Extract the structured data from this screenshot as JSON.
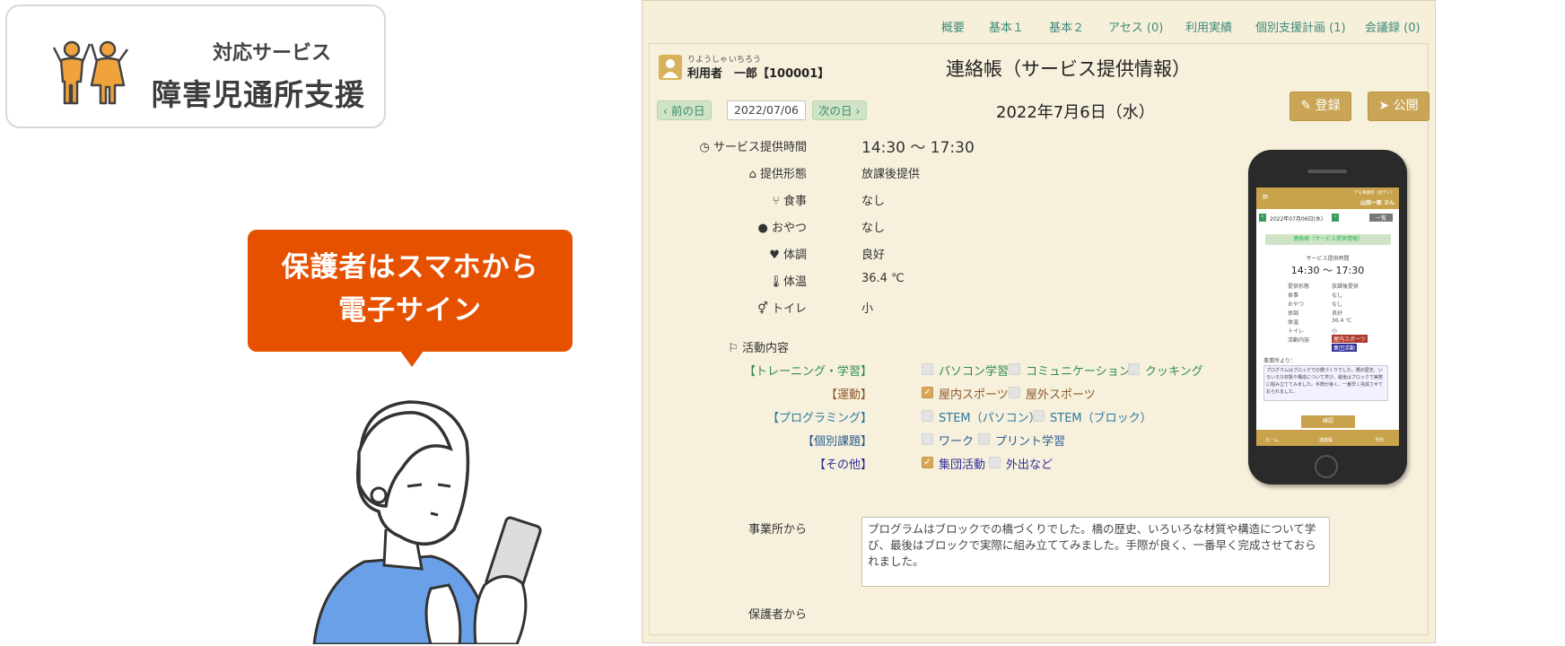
{
  "promo": {
    "service_label": "対応サービス",
    "service_name": "障害児通所支援",
    "bubble_line1": "保護者はスマホから",
    "bubble_line2": "電子サイン",
    "accent_color": "#e65100",
    "icon": "children-icon"
  },
  "nav": {
    "tabs": [
      "概要",
      "基本１",
      "基本２",
      "アセス (0)",
      "利用実績",
      "個別支援計画 (1)",
      "会議録 (0)"
    ]
  },
  "user": {
    "furigana_role": "りようしゃ",
    "furigana_name": "いちろう",
    "name_line": "利用者　一郎【100001】"
  },
  "page": {
    "title": "連絡帳（サービス提供情報）",
    "prev_day": "前の日",
    "next_day": "次の日",
    "date_value": "2022/07/06",
    "day_title": "2022年7月6日（水）",
    "register_label": "登録",
    "publish_label": "公開"
  },
  "info": {
    "service_time_label": "サービス提供時間",
    "service_time_value": "14:30 〜 17:30",
    "form_label": "提供形態",
    "form_value": "放課後提供",
    "meal_label": "食事",
    "meal_value": "なし",
    "snack_label": "おやつ",
    "snack_value": "なし",
    "condition_label": "体調",
    "condition_value": "良好",
    "temp_label": "体温",
    "temp_value": "36.4 ℃",
    "toilet_label": "トイレ",
    "toilet_value": "小",
    "activity_label": "活動内容"
  },
  "activities": {
    "training": {
      "label": "【トレーニング・学習】",
      "items": [
        "パソコン学習",
        "コミュニケーション",
        "クッキング"
      ]
    },
    "exercise": {
      "label": "【運動】",
      "items": [
        "屋内スポーツ",
        "屋外スポーツ"
      ]
    },
    "programming": {
      "label": "【プログラミング】",
      "items": [
        "STEM（パソコン）",
        "STEM（ブロック）"
      ]
    },
    "individual": {
      "label": "【個別課題】",
      "items": [
        "ワーク",
        "プリント学習"
      ]
    },
    "other": {
      "label": "【その他】",
      "items": [
        "集団活動",
        "外出など"
      ]
    }
  },
  "comments": {
    "office_label": "事業所から",
    "office_text": "プログラムはブロックでの橋づくりでした。橋の歴史、いろいろな材質や構造について学び、最後はブロックで実際に組み立ててみました。手際が良く、一番早く完成させておられました。",
    "guardian_label": "保護者から"
  },
  "phone": {
    "header_sub": "デモ事業所（放デイ）",
    "header_user": "山田一郎 さん",
    "date": "2022年07月06日(水)",
    "date_btn": "一覧",
    "title": "連絡帳（サービス提供情報）",
    "time_label": "サービス提供時間",
    "time_value": "14:30 〜 17:30",
    "rows": [
      [
        "提供形態",
        "放課後提供"
      ],
      [
        "食事",
        "なし"
      ],
      [
        "おやつ",
        "なし"
      ],
      [
        "体調",
        "良好"
      ],
      [
        "体温",
        "36.4 ℃"
      ],
      [
        "トイレ",
        "小"
      ]
    ],
    "activity_label": "活動内容",
    "tag1": "屋内スポーツ",
    "tag2": "集団活動",
    "office_label": "事業所より：",
    "office_text": "プログラムはブロックでの橋づくりでした。橋の歴史、いろいろな材質や構造について学び、最後はブロックで実際に組み立ててみました。手際が良く、一番早く完成させておられました。",
    "sign_btn": "確認",
    "footer": [
      "ホーム",
      "連絡帳",
      "予約"
    ]
  }
}
